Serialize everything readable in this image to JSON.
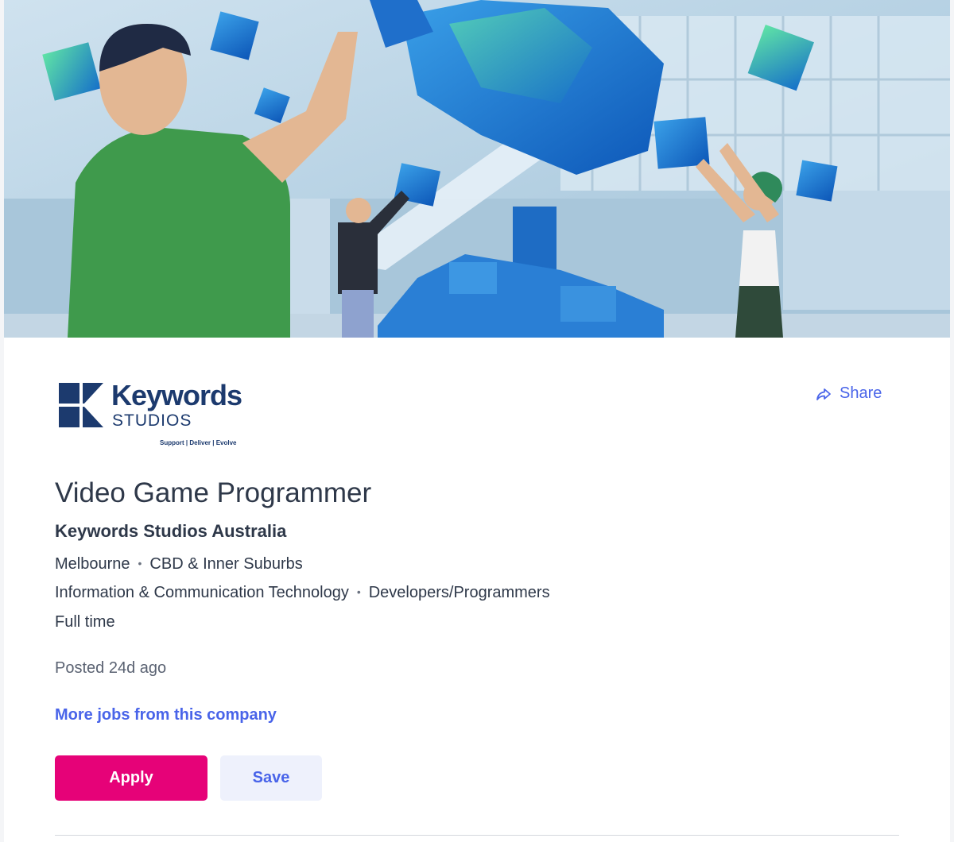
{
  "company_logo": {
    "wordmark": "Keywords",
    "sub": "STUDIOS",
    "tagline": "Support | Deliver | Evolve"
  },
  "share": {
    "label": "Share",
    "icon": "share-arrow-icon"
  },
  "job": {
    "title": "Video Game Programmer",
    "company": "Keywords Studios Australia",
    "location": "Melbourne",
    "area": "CBD & Inner Suburbs",
    "classification": "Information & Communication Technology",
    "sub_classification": "Developers/Programmers",
    "work_type": "Full time",
    "posted": "Posted 24d ago"
  },
  "links": {
    "more_jobs": "More jobs from this company"
  },
  "actions": {
    "apply_label": "Apply",
    "save_label": "Save"
  },
  "colors": {
    "accent": "#4964e9",
    "apply": "#e60278",
    "save_bg": "#eef1fc",
    "brand_navy": "#1c3a6e"
  }
}
